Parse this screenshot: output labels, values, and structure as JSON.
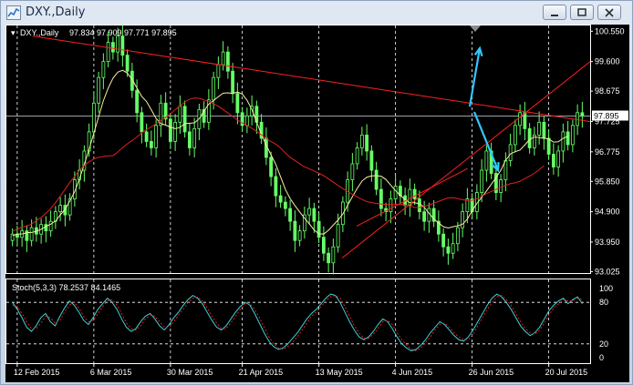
{
  "window": {
    "title": "DXY.,Daily"
  },
  "chart_data": [
    {
      "type": "candlestick",
      "symbol_label": "DXY.,Daily",
      "ohlc_label": "97.834 97.909 97.771 97.895",
      "last_price": "97.895",
      "y_ticks": [
        "100.550",
        "99.600",
        "98.675",
        "97.725",
        "96.775",
        "95.850",
        "94.900",
        "93.950",
        "93.025"
      ],
      "y_tick_values": [
        100.55,
        99.6,
        98.675,
        97.725,
        96.775,
        95.85,
        94.9,
        93.95,
        93.025
      ],
      "ylim": [
        92.98,
        100.73
      ],
      "x_ticks": [
        "12 Feb 2015",
        "6 Mar 2015",
        "30 Mar 2015",
        "21 Apr 2015",
        "13 May 2015",
        "4 Jun 2015",
        "26 Jun 2015",
        "20 Jul 2015"
      ],
      "close_series": [
        94.2,
        94.1,
        94.3,
        94.0,
        94.4,
        94.2,
        94.5,
        94.3,
        94.6,
        94.9,
        95.1,
        94.8,
        95.3,
        95.9,
        96.2,
        96.8,
        97.4,
        98.3,
        99.1,
        99.6,
        100.2,
        99.9,
        100.4,
        99.8,
        99.3,
        98.7,
        98.0,
        97.4,
        97.1,
        96.9,
        97.6,
        98.3,
        97.8,
        97.1,
        97.7,
        98.2,
        97.4,
        96.9,
        97.5,
        98.1,
        97.7,
        98.4,
        99.1,
        99.5,
        99.9,
        99.3,
        98.6,
        98.0,
        97.6,
        97.9,
        98.2,
        97.7,
        97.2,
        96.6,
        96.0,
        95.4,
        95.2,
        95.0,
        94.6,
        94.0,
        94.3,
        94.8,
        95.0,
        94.6,
        94.1,
        93.6,
        93.3,
        93.8,
        94.5,
        95.2,
        95.9,
        96.4,
        96.9,
        97.3,
        96.8,
        96.2,
        95.6,
        95.0,
        94.9,
        95.3,
        95.7,
        95.4,
        95.1,
        95.6,
        95.3,
        94.9,
        94.6,
        95.0,
        94.6,
        94.2,
        93.8,
        93.6,
        93.9,
        94.4,
        94.9,
        95.3,
        94.9,
        95.5,
        96.2,
        96.8,
        96.1,
        95.5,
        95.9,
        96.5,
        97.0,
        97.6,
        98.0,
        97.5,
        96.9,
        97.3,
        97.7,
        97.2,
        96.7,
        96.3,
        96.8,
        97.4,
        97.0,
        97.6,
        98.0,
        97.895
      ],
      "ma_fast_label": "MA (yellow)",
      "ma_slow_label": "MA (red)",
      "trendlines": [
        {
          "color": "#ff2020",
          "from": [
            0.045,
            100.4
          ],
          "to": [
            1.0,
            97.72
          ]
        },
        {
          "color": "#ff2020",
          "from": [
            0.575,
            93.45
          ],
          "to": [
            1.0,
            99.6
          ]
        },
        {
          "color": "#ff2020",
          "from": [
            0.6,
            94.45
          ],
          "to": [
            0.79,
            96.25
          ]
        }
      ],
      "arrows": [
        {
          "color": "#30c8ff",
          "direction": "up"
        },
        {
          "color": "#30c8ff",
          "direction": "down"
        }
      ]
    },
    {
      "type": "line",
      "indicator_label": "Stoch(5,3,3) 78.2537 84.1465",
      "y_ticks": [
        "100",
        "80",
        "20",
        "0"
      ],
      "ylim": [
        0,
        100
      ],
      "levels": [
        80,
        20
      ],
      "series": [
        {
          "values": [
            80,
            70,
            58,
            44,
            38,
            46,
            58,
            64,
            52,
            46,
            60,
            72,
            82,
            76,
            66,
            54,
            48,
            58,
            70,
            78,
            86,
            80,
            70,
            56,
            44,
            38,
            42,
            52,
            60,
            64,
            56,
            46,
            40,
            48,
            58,
            66,
            76,
            84,
            90,
            86,
            78,
            66,
            54,
            44,
            40,
            46,
            56,
            66,
            74,
            80,
            76,
            64,
            50,
            36,
            24,
            16,
            12,
            14,
            20,
            28,
            36,
            46,
            56,
            64,
            70,
            78,
            86,
            92,
            90,
            80,
            66,
            52,
            40,
            30,
            26,
            30,
            38,
            48,
            56,
            52,
            42,
            30,
            20,
            14,
            10,
            12,
            18,
            26,
            36,
            44,
            52,
            48,
            40,
            32,
            26,
            24,
            30,
            40,
            52,
            64,
            76,
            86,
            92,
            88,
            80,
            70,
            58,
            46,
            38,
            32,
            36,
            44,
            56,
            68,
            76,
            82,
            86,
            78,
            84,
            88,
            78
          ]
        },
        {
          "values": [
            76,
            74,
            64,
            52,
            42,
            42,
            50,
            60,
            58,
            50,
            54,
            66,
            76,
            80,
            72,
            60,
            52,
            54,
            64,
            74,
            82,
            84,
            76,
            64,
            50,
            42,
            40,
            46,
            56,
            62,
            60,
            52,
            44,
            44,
            52,
            62,
            70,
            80,
            86,
            88,
            82,
            72,
            60,
            50,
            42,
            42,
            50,
            60,
            70,
            78,
            78,
            70,
            58,
            44,
            30,
            20,
            14,
            12,
            16,
            22,
            30,
            40,
            50,
            60,
            66,
            74,
            82,
            88,
            90,
            86,
            74,
            60,
            46,
            36,
            28,
            28,
            34,
            42,
            52,
            54,
            48,
            36,
            26,
            18,
            12,
            10,
            14,
            22,
            30,
            40,
            48,
            50,
            44,
            36,
            30,
            26,
            26,
            34,
            46,
            58,
            70,
            80,
            88,
            90,
            84,
            76,
            64,
            52,
            42,
            36,
            34,
            40,
            50,
            62,
            72,
            78,
            84,
            82,
            82,
            86,
            84
          ]
        }
      ]
    }
  ]
}
